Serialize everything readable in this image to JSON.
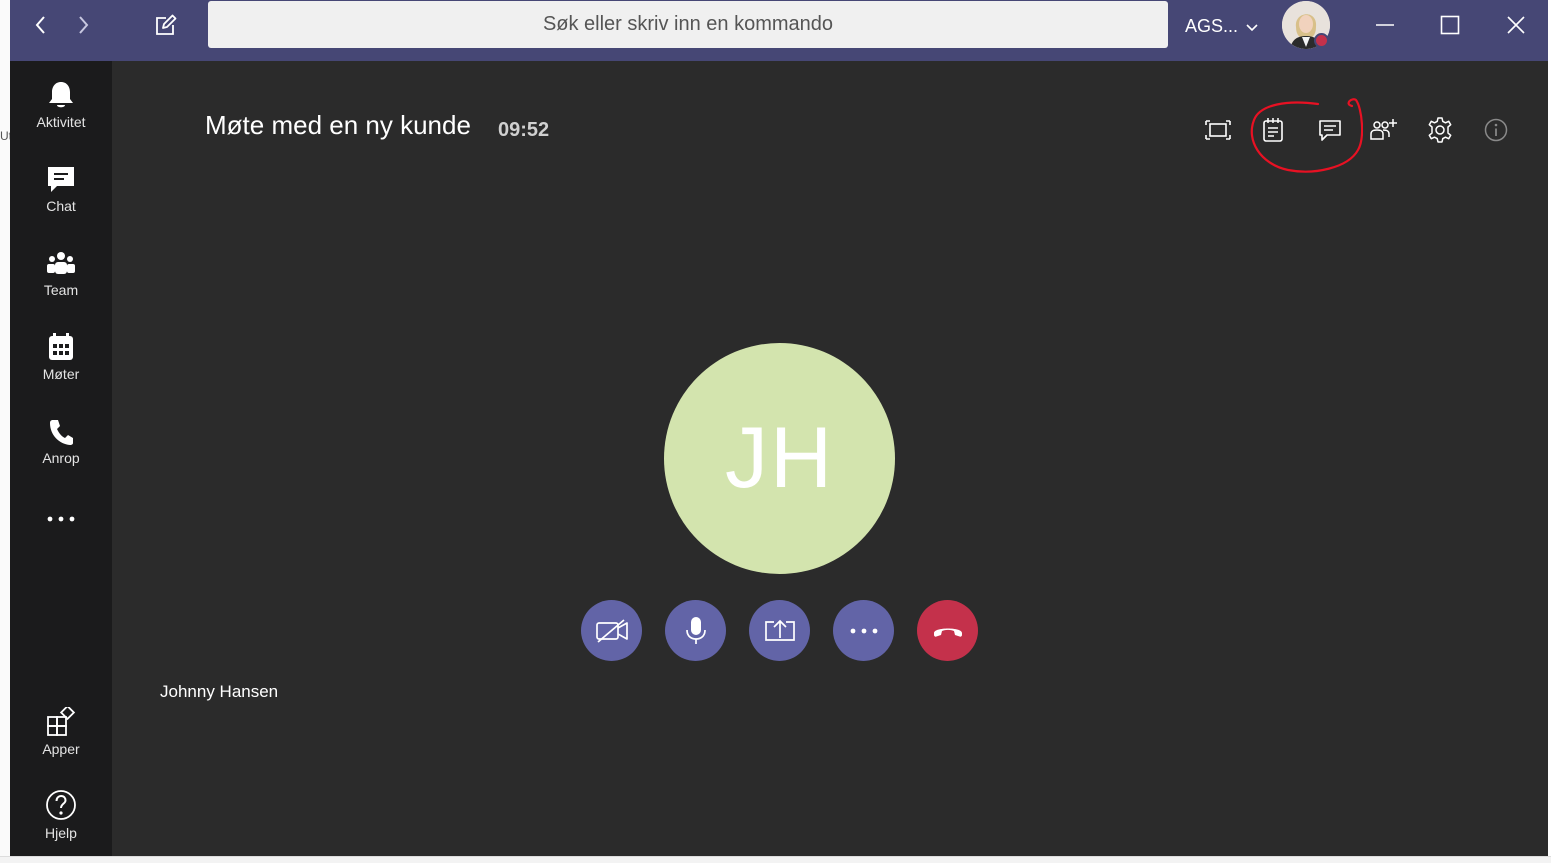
{
  "window": {
    "search_placeholder": "Søk eller skriv inn en kommando",
    "org_name": "AGS...",
    "nav_back_icon": "chevron-left-icon",
    "nav_forward_icon": "chevron-right-icon",
    "compose_icon": "compose-icon",
    "controls": [
      "minimize-icon",
      "maximize-icon",
      "close-icon"
    ],
    "presence_color": "#c4314b",
    "accent": "#464775"
  },
  "sidebar": {
    "items": [
      {
        "label": "Aktivitet",
        "icon": "bell-icon"
      },
      {
        "label": "Chat",
        "icon": "chat-icon"
      },
      {
        "label": "Team",
        "icon": "teams-icon"
      },
      {
        "label": "Møter",
        "icon": "calendar-icon"
      },
      {
        "label": "Anrop",
        "icon": "phone-icon"
      },
      {
        "label": "",
        "icon": "more-icon"
      }
    ],
    "bottom": [
      {
        "label": "Apper",
        "icon": "apps-icon"
      },
      {
        "label": "Hjelp",
        "icon": "help-icon"
      }
    ]
  },
  "meeting": {
    "title": "Møte med en ny kunde",
    "elapsed": "09:52",
    "header_icons": [
      "fullscreen-icon",
      "meeting-notes-icon",
      "conversation-icon",
      "participants-icon",
      "settings-icon",
      "info-icon"
    ],
    "participant": {
      "initials": "JH",
      "name": "Johnny Hansen",
      "avatar_color": "#d3e4ae"
    },
    "controls": [
      {
        "name": "camera-off",
        "icon": "video-off-icon"
      },
      {
        "name": "microphone",
        "icon": "microphone-icon"
      },
      {
        "name": "share",
        "icon": "share-screen-icon"
      },
      {
        "name": "more",
        "icon": "more-icon"
      },
      {
        "name": "hang-up",
        "icon": "hang-up-icon",
        "color": "#c4314b"
      }
    ],
    "control_color": "#6264a7"
  },
  "edge": {
    "left_fragment": "Ut"
  }
}
